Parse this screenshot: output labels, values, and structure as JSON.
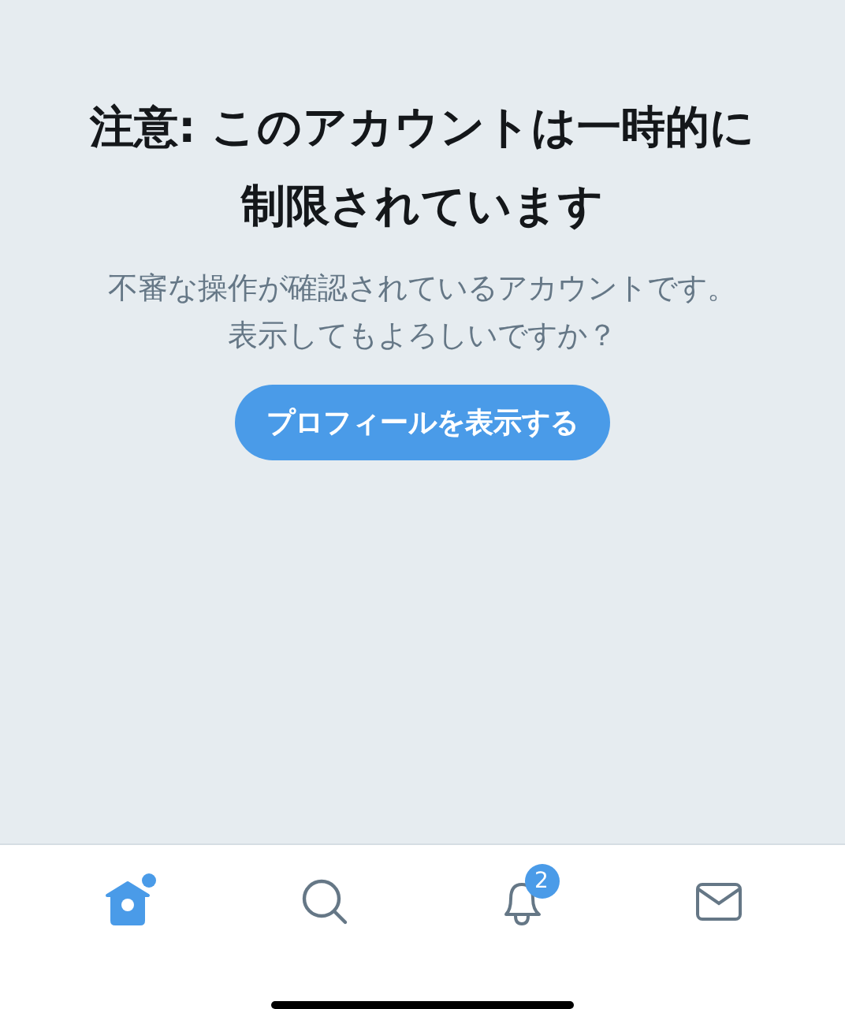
{
  "notice": {
    "title": "注意: このアカウントは一時的に制限されています",
    "message": "不審な操作が確認されているアカウントです。表示してもよろしいですか？",
    "button": "プロフィールを表示する"
  },
  "tab_bar": [
    {
      "kind": "home",
      "selected": true,
      "dot": true
    },
    {
      "kind": "search",
      "selected": false,
      "dot": false
    },
    {
      "kind": "notifications",
      "selected": false,
      "dot": false,
      "badge": "2"
    },
    {
      "kind": "messages",
      "selected": false,
      "dot": false
    }
  ]
}
